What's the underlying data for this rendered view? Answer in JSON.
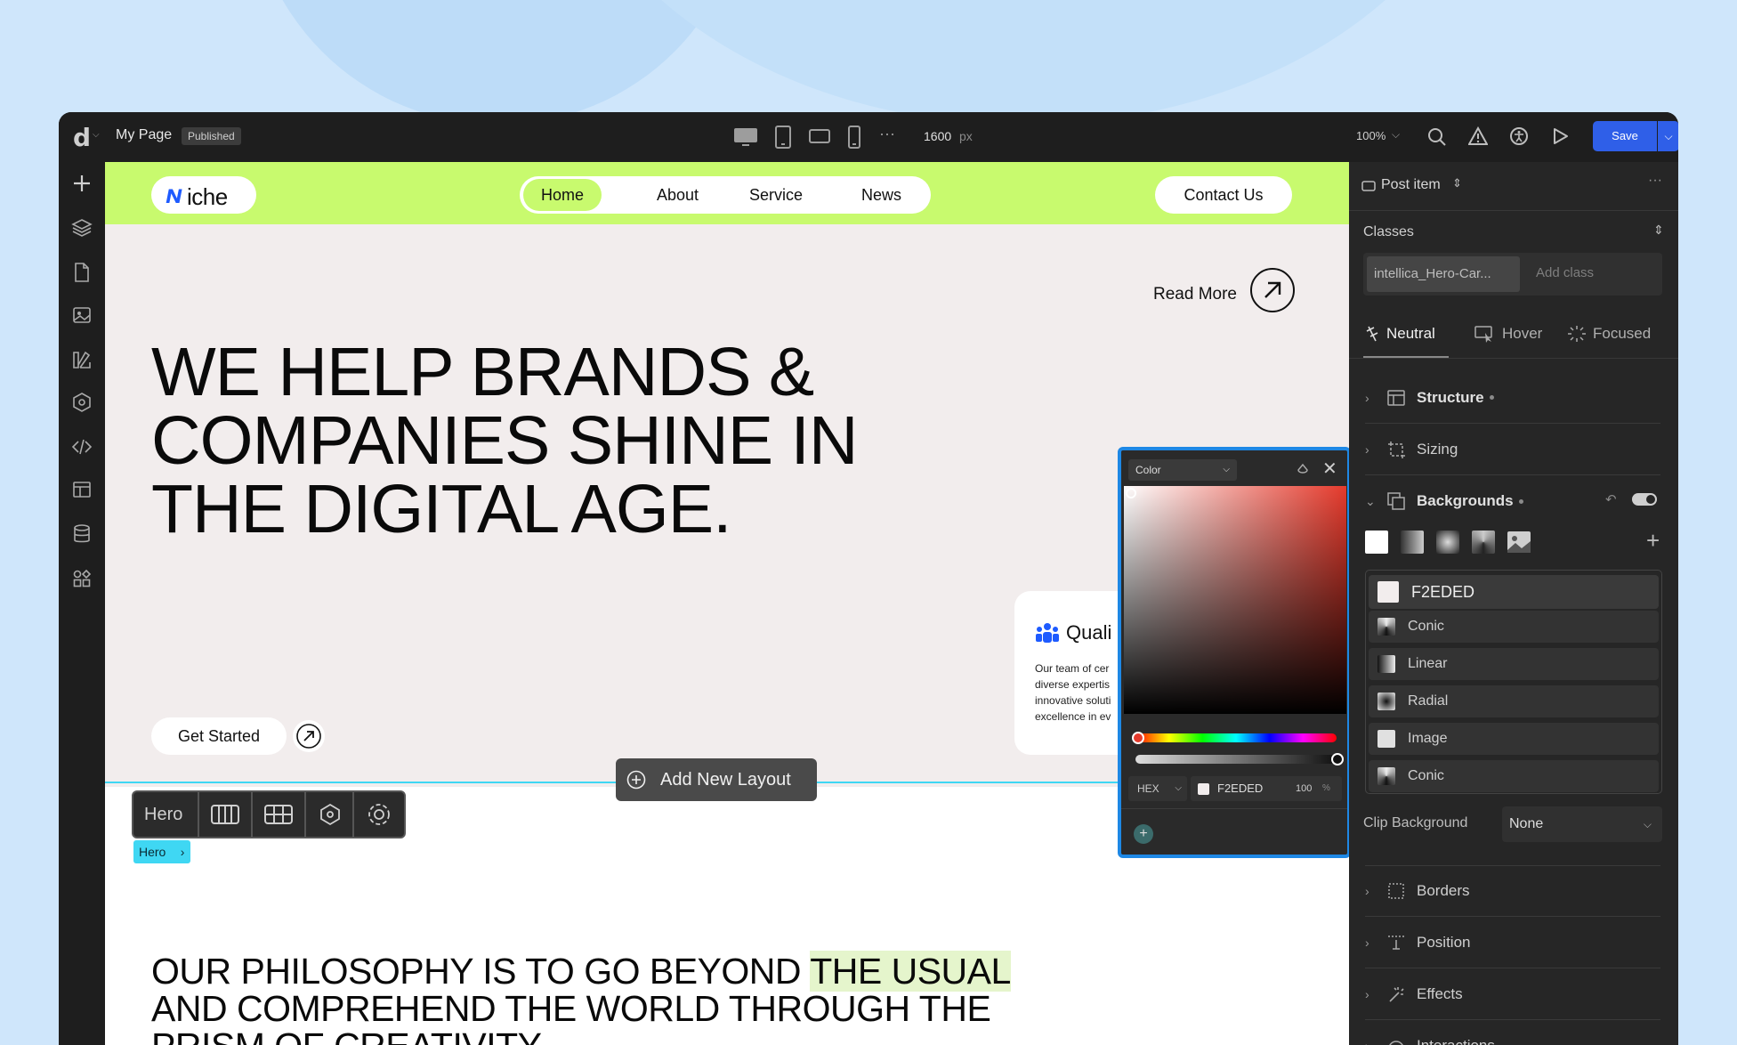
{
  "topbar": {
    "logo": "d",
    "page_name": "My Page",
    "status_badge": "Published",
    "width_value": "1600",
    "width_unit": "px",
    "zoom": "100%",
    "save_label": "Save"
  },
  "site": {
    "logo_text": "iche",
    "nav": [
      "Home",
      "About",
      "Service",
      "News"
    ],
    "contact": "Contact Us",
    "read_more": "Read More",
    "hero_line1": "WE HELP BRANDS &",
    "hero_line2": "COMPANIES SHINE IN",
    "hero_line3": "THE DIGITAL AGE.",
    "card_title": "Quali",
    "card_text1": "Our team of cer",
    "card_text2": "diverse expertis",
    "card_text3": "innovative soluti",
    "card_text4": "excellence in ev",
    "get_started": "Get Started",
    "add_layout": "Add New Layout",
    "philosophy_1a": "OUR PHILOSOPHY IS TO GO BEYOND ",
    "philosophy_1b": "THE USUAL",
    "philosophy_2": "AND COMPREHEND THE WORLD THROUGH THE",
    "philosophy_3": "PRISM OF CREATIVITY"
  },
  "section_toolbar": {
    "label": "Hero",
    "tag": "Hero"
  },
  "color_picker": {
    "mode": "Color",
    "format": "HEX",
    "hex": "F2EDED",
    "alpha": "100",
    "alpha_unit": "%"
  },
  "panel": {
    "element": "Post item",
    "classes_label": "Classes",
    "class_chip": "intellica_Hero-Car...",
    "add_class": "Add class",
    "states": [
      "Neutral",
      "Hover",
      "Focused"
    ],
    "sections": {
      "structure": "Structure",
      "sizing": "Sizing",
      "backgrounds": "Backgrounds",
      "borders": "Borders",
      "position": "Position",
      "effects": "Effects",
      "interactions": "Interactions"
    },
    "bg_layers": [
      {
        "name": "F2EDED",
        "swatch": "#f2eded"
      },
      {
        "name": "Conic",
        "swatch": "conic"
      },
      {
        "name": "Linear",
        "swatch": "linear"
      },
      {
        "name": "Radial",
        "swatch": "radial"
      },
      {
        "name": "Image",
        "swatch": "#e0e0e0"
      },
      {
        "name": "Conic",
        "swatch": "conic"
      }
    ],
    "clip_label": "Clip Background",
    "clip_value": "None"
  },
  "colors": {
    "lime": "#c8fa6e",
    "hero_bg": "#f2eded",
    "accent_blue": "#1e5bff",
    "cyan": "#3fd7f3"
  }
}
